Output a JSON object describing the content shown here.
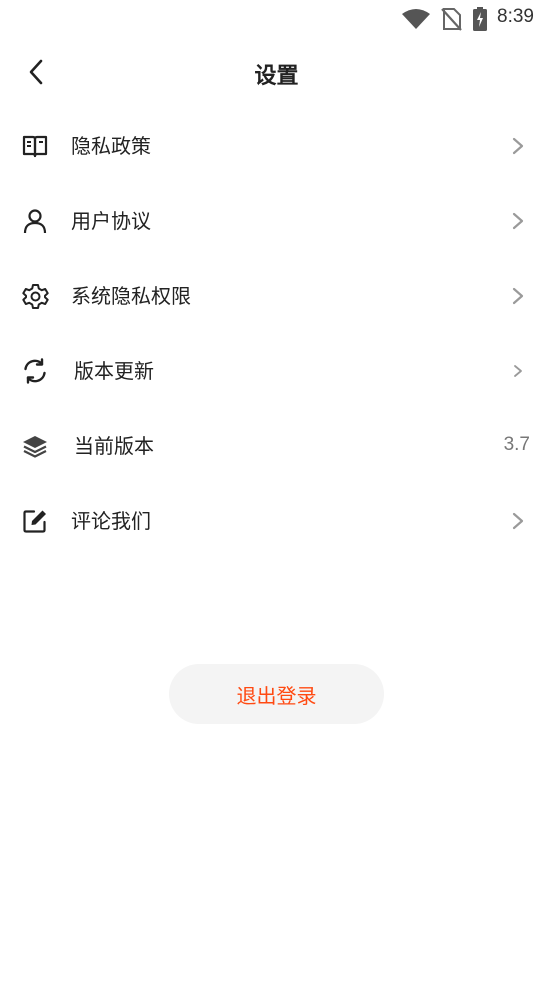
{
  "status_bar": {
    "time": "8:39"
  },
  "header": {
    "title": "设置"
  },
  "settings": {
    "items": [
      {
        "label": "隐私政策",
        "icon": "book-icon"
      },
      {
        "label": "用户协议",
        "icon": "user-icon"
      },
      {
        "label": "系统隐私权限",
        "icon": "gear-icon"
      },
      {
        "label": "版本更新",
        "icon": "refresh-icon"
      },
      {
        "label": "当前版本",
        "icon": "layers-icon",
        "value": "3.7"
      },
      {
        "label": "评论我们",
        "icon": "edit-icon"
      }
    ]
  },
  "logout": {
    "label": "退出登录"
  },
  "colors": {
    "accent": "#ff4a12",
    "chevron": "#9a9a9a",
    "button_bg": "#f4f4f4"
  }
}
